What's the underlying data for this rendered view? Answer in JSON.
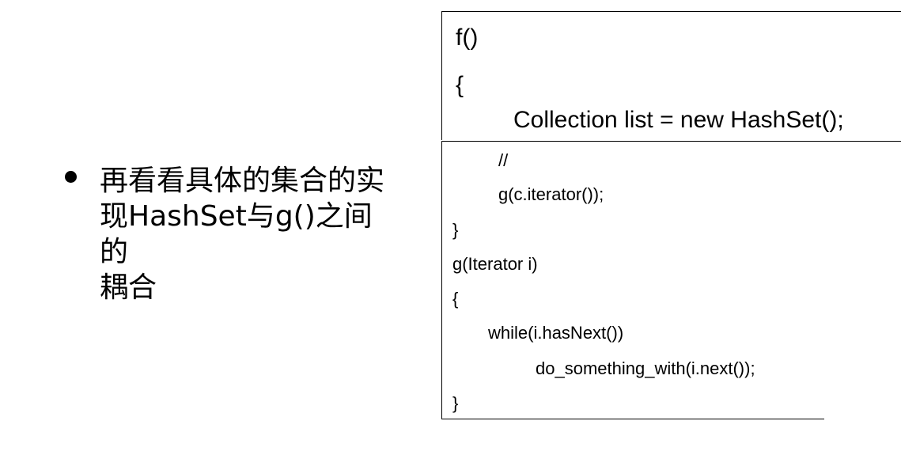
{
  "bullet": {
    "line1": "再看看具体的集合的实",
    "line2": "现HashSet与g()之间的",
    "line3": "耦合"
  },
  "code_top": {
    "line1": "f()",
    "line2": "{",
    "line3": "Collection list = new HashSet();"
  },
  "code_bottom": {
    "line1": "//",
    "line2": "g(c.iterator());",
    "line3": "}",
    "line4": "g(Iterator i)",
    "line5": "{",
    "line6": "while(i.hasNext())",
    "line7": "do_something_with(i.next());",
    "line8": "}"
  }
}
